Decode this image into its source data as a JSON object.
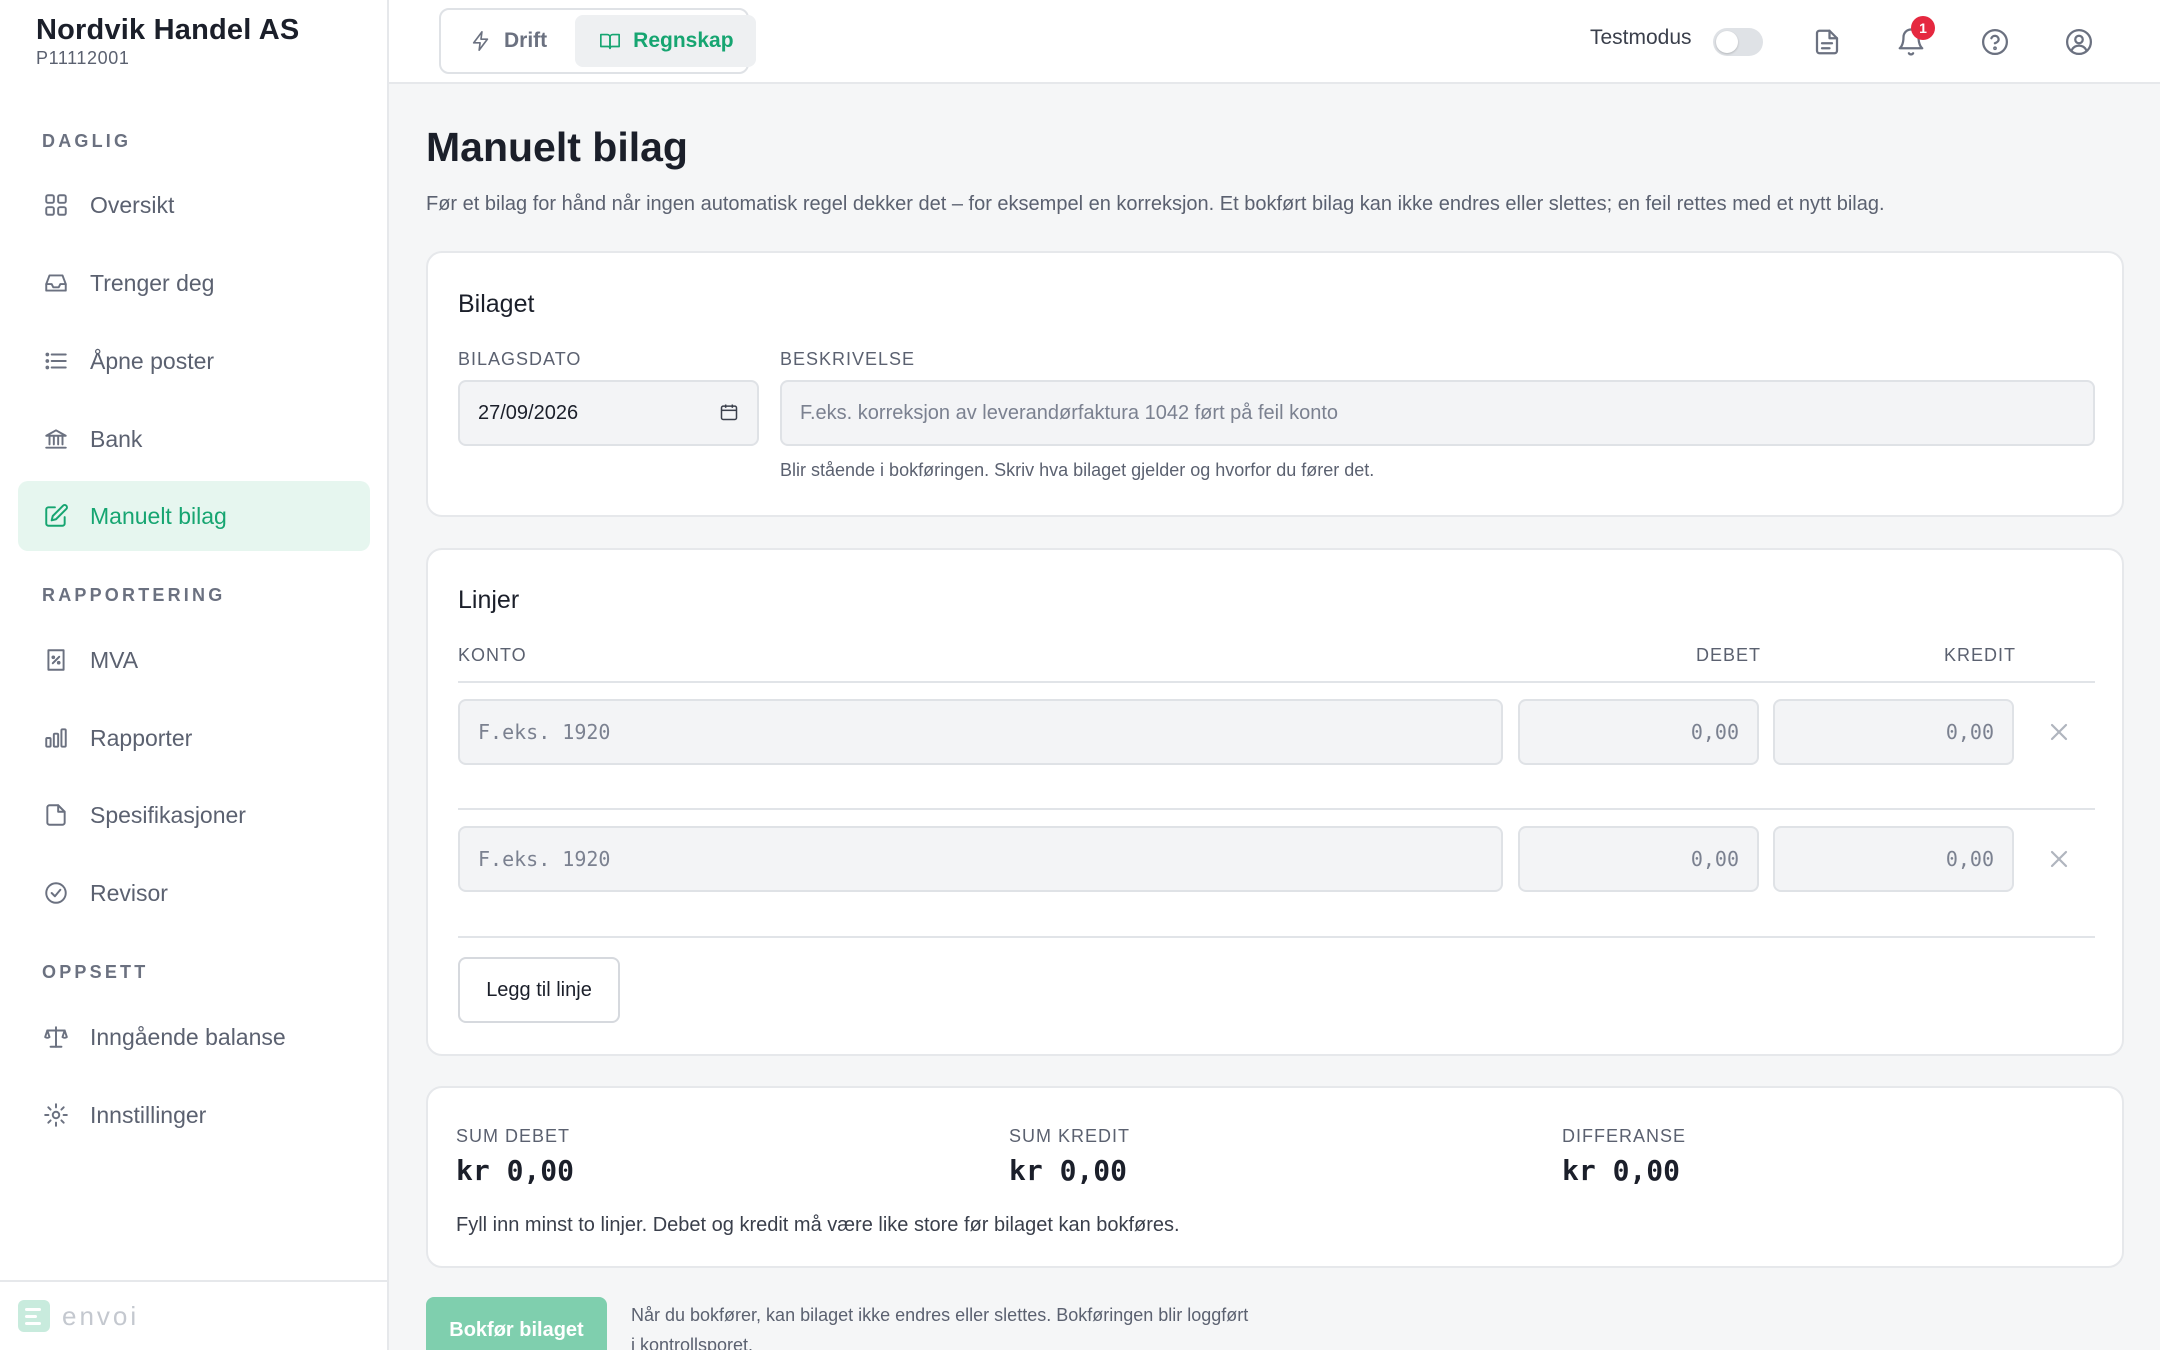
{
  "org": {
    "name": "Nordvik Handel AS",
    "id": "P11112001"
  },
  "sidebar": {
    "sections": [
      {
        "label": "DAGLIG",
        "items": [
          {
            "label": "Oversikt",
            "icon": "grid-icon"
          },
          {
            "label": "Trenger deg",
            "icon": "inbox-icon"
          },
          {
            "label": "Åpne poster",
            "icon": "list-icon"
          },
          {
            "label": "Bank",
            "icon": "bank-icon"
          },
          {
            "label": "Manuelt bilag",
            "icon": "edit-icon",
            "active": true
          }
        ]
      },
      {
        "label": "RAPPORTERING",
        "items": [
          {
            "label": "MVA",
            "icon": "percent-receipt-icon"
          },
          {
            "label": "Rapporter",
            "icon": "bar-chart-icon"
          },
          {
            "label": "Spesifikasjoner",
            "icon": "document-icon"
          },
          {
            "label": "Revisor",
            "icon": "check-circle-icon"
          }
        ]
      },
      {
        "label": "OPPSETT",
        "items": [
          {
            "label": "Inngående balanse",
            "icon": "scale-icon"
          },
          {
            "label": "Innstillinger",
            "icon": "gear-icon"
          }
        ]
      }
    ],
    "footer_logo": "envoi"
  },
  "topbar": {
    "tabs": [
      {
        "label": "Drift",
        "icon": "bolt-icon",
        "active": false
      },
      {
        "label": "Regnskap",
        "icon": "book-icon",
        "active": true
      }
    ],
    "testmode_label": "Testmodus",
    "testmode_on": false,
    "notification_count": "1"
  },
  "page": {
    "title": "Manuelt bilag",
    "description": "Før et bilag for hånd når ingen automatisk regel dekker det – for eksempel en korreksjon. Et bokført bilag kan ikke endres eller slettes; en feil rettes med et nytt bilag."
  },
  "bilaget": {
    "title": "Bilaget",
    "date_label": "BILAGSDATO",
    "date_value": "27/09/2026",
    "desc_label": "BESKRIVELSE",
    "desc_placeholder": "F.eks. korreksjon av leverandørfaktura 1042 ført på feil konto",
    "desc_helper": "Blir stående i bokføringen. Skriv hva bilaget gjelder og hvorfor du fører det."
  },
  "linjer": {
    "title": "Linjer",
    "col_konto": "KONTO",
    "col_debet": "DEBET",
    "col_kredit": "KREDIT",
    "rows": [
      {
        "konto_placeholder": "F.eks. 1920",
        "debet_placeholder": "0,00",
        "kredit_placeholder": "0,00"
      },
      {
        "konto_placeholder": "F.eks. 1920",
        "debet_placeholder": "0,00",
        "kredit_placeholder": "0,00"
      }
    ],
    "add_label": "Legg til linje"
  },
  "summary": {
    "sum_debet_label": "SUM DEBET",
    "sum_debet_value": "kr 0,00",
    "sum_kredit_label": "SUM KREDIT",
    "sum_kredit_value": "kr 0,00",
    "diff_label": "DIFFERANSE",
    "diff_value": "kr 0,00",
    "note": "Fyll inn minst to linjer. Debet og kredit må være like store før bilaget kan bokføres."
  },
  "submit": {
    "label": "Bokfør bilaget",
    "note": "Når du bokfører, kan bilaget ikke endres eller slettes. Bokføringen blir loggført i kontrollsporet."
  },
  "colors": {
    "accent": "#16a571",
    "accent_bg": "#e6f6ef",
    "primary_disabled": "#7fcfae",
    "badge": "#e5283f"
  }
}
